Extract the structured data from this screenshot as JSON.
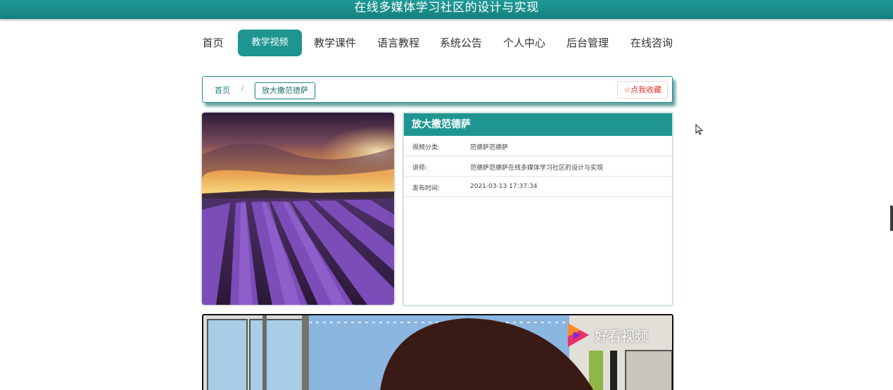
{
  "header": {
    "site_title": "在线多媒体学习社区的设计与实现"
  },
  "nav": {
    "items": [
      {
        "label": "首页"
      },
      {
        "label": "教学视频",
        "active": true
      },
      {
        "label": "教学课件"
      },
      {
        "label": "语言教程"
      },
      {
        "label": "系统公告"
      },
      {
        "label": "个人中心"
      },
      {
        "label": "后台管理"
      },
      {
        "label": "在线咨询"
      }
    ]
  },
  "breadcrumb": {
    "home": "首页",
    "separator": "/",
    "current": "放大撒范德萨"
  },
  "favorite_button": {
    "icon": "star-outline-icon",
    "label": "点我收藏"
  },
  "detail": {
    "title": "放大撒范德萨",
    "rows": [
      {
        "label": "视频分类:",
        "value": "范德萨范德萨"
      },
      {
        "label": "讲师:",
        "value": "范德萨范德萨在线多媒体学习社区的设计与实现"
      },
      {
        "label": "发布时间:",
        "value": "2021-03-13 17:37:34"
      }
    ]
  },
  "video": {
    "watermark": "好看视频",
    "logo_icon": "play-triangle-icon"
  },
  "colors": {
    "accent": "#1e9590",
    "favorite": "#e0352a"
  }
}
